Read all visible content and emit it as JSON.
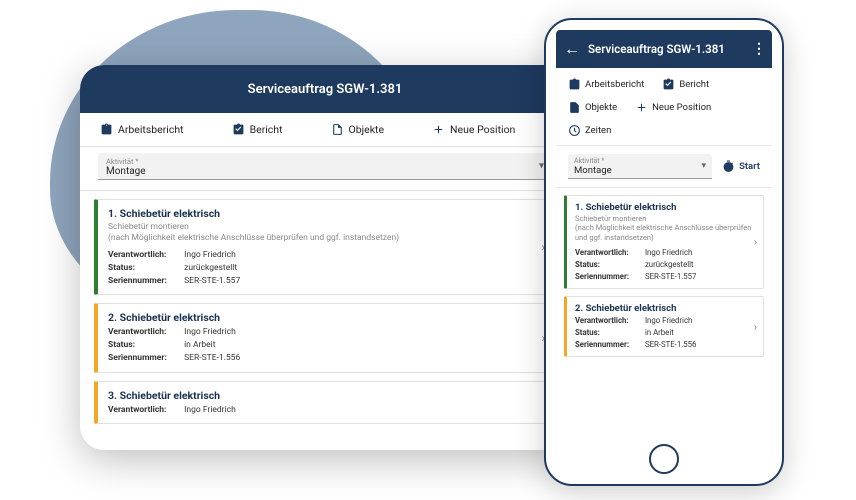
{
  "header": {
    "title": "Serviceauftrag SGW-1.381"
  },
  "tabs": {
    "arbeitsbericht": "Arbeitsbericht",
    "bericht": "Bericht",
    "objekte": "Objekte",
    "neue_position": "Neue Position",
    "zeiten": "Zeiten"
  },
  "select": {
    "label": "Aktivität *",
    "value": "Montage"
  },
  "start_label": "Start",
  "cards": [
    {
      "title": "1. Schiebetür elektrisch",
      "sub1": "Schiebetür montieren",
      "sub2": "(nach Möglichkeit elektrische Anschlüsse überprüfen und ggf. instandsetzen)",
      "verantwortlich_label": "Verantwortlich:",
      "verantwortlich": "Ingo Friedrich",
      "status_label": "Status:",
      "status": "zurückgestellt",
      "serien_label": "Seriennummer:",
      "serien": "SER-STE-1.557",
      "color": "green"
    },
    {
      "title": "2. Schiebetür elektrisch",
      "verantwortlich_label": "Verantwortlich:",
      "verantwortlich": "Ingo Friedrich",
      "status_label": "Status:",
      "status": "in Arbeit",
      "serien_label": "Seriennummer:",
      "serien": "SER-STE-1.556",
      "color": "orange"
    },
    {
      "title": "3. Schiebetür elektrisch",
      "verantwortlich_label": "Verantwortlich:",
      "verantwortlich": "Ingo Friedrich",
      "color": "orange"
    }
  ]
}
